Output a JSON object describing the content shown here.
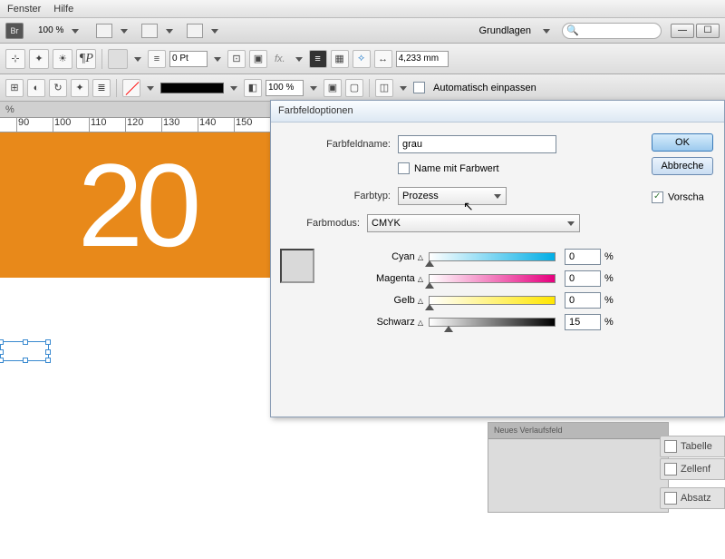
{
  "menu": {
    "fenster": "Fenster",
    "hilfe": "Hilfe",
    "br": "Br"
  },
  "top": {
    "zoom": "100 %",
    "workspace": "Grundlagen"
  },
  "toolbar": {
    "pt": "0 Pt",
    "opacity": "100 %",
    "width": "4,233 mm",
    "autofit": "Automatisch einpassen"
  },
  "tab": {
    "pct": "%"
  },
  "ruler_start": 80,
  "canvas": {
    "big": "20"
  },
  "dialog": {
    "title": "Farbfeldoptionen",
    "name_lbl": "Farbfeldname:",
    "name_val": "grau",
    "name_with_value": "Name mit Farbwert",
    "type_lbl": "Farbtyp:",
    "type_val": "Prozess",
    "mode_lbl": "Farbmodus:",
    "mode_val": "CMYK",
    "ok": "OK",
    "cancel": "Abbreche",
    "preview": "Vorscha",
    "sliders": {
      "c": {
        "lbl": "Cyan",
        "val": "0"
      },
      "m": {
        "lbl": "Magenta",
        "val": "0"
      },
      "y": {
        "lbl": "Gelb",
        "val": "0"
      },
      "k": {
        "lbl": "Schwarz",
        "val": "15"
      }
    },
    "pct": "%"
  },
  "panels": {
    "hdr": "Neues Verlaufsfeld",
    "p1": "Tabelle",
    "p2": "Zellenf",
    "p3": "Absatz"
  },
  "chart_data": {
    "type": "table",
    "title": "CMYK Farbfeld",
    "categories": [
      "Cyan",
      "Magenta",
      "Gelb",
      "Schwarz"
    ],
    "values": [
      0,
      0,
      0,
      15
    ],
    "ylim": [
      0,
      100
    ]
  }
}
